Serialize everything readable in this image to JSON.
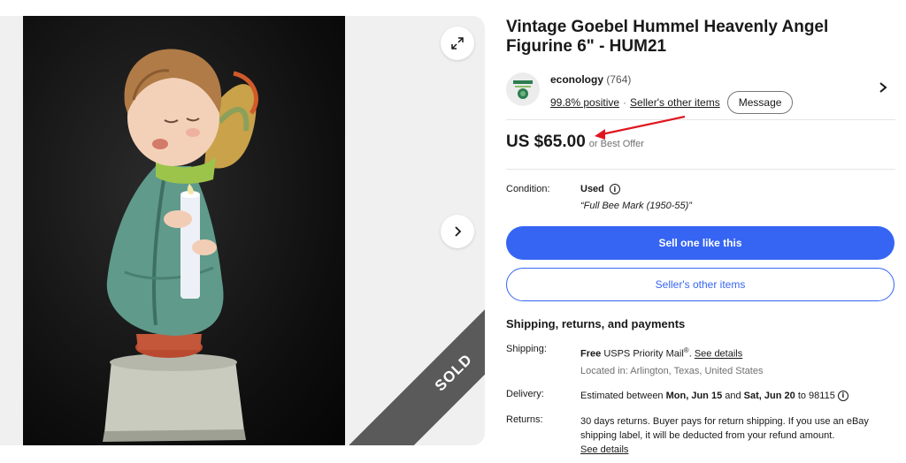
{
  "listing": {
    "title": "Vintage Goebel Hummel Heavenly Angel Figurine 6\" - HUM21",
    "sold_badge": "SOLD"
  },
  "seller": {
    "name": "econology",
    "feedback_count": "(764)",
    "positive": "99.8% positive",
    "separator": "·",
    "other_items_link": "Seller's other items",
    "message_button": "Message"
  },
  "price": {
    "amount": "US $65.00",
    "best_offer": "or Best Offer"
  },
  "condition": {
    "label": "Condition:",
    "value": "Used",
    "note": "“Full Bee Mark (1950-55)”"
  },
  "actions": {
    "sell_one": "Sell one like this",
    "seller_other_items": "Seller's other items"
  },
  "shipping": {
    "heading": "Shipping, returns, and payments",
    "shipping_label": "Shipping:",
    "shipping_free": "Free",
    "shipping_service": "USPS Priority Mail",
    "shipping_reg": "®",
    "shipping_period": ".",
    "see_details": "See details",
    "location": "Located in: Arlington, Texas, United States",
    "delivery_label": "Delivery:",
    "delivery_prefix": "Estimated between",
    "delivery_start": "Mon, Jun 15",
    "delivery_and": "and",
    "delivery_end": "Sat, Jun 20",
    "delivery_to": "to 98115",
    "returns_label": "Returns:",
    "returns_text": "30 days returns. Buyer pays for return shipping. If you use an eBay shipping label, it will be deducted from your refund amount.",
    "returns_details": "See details"
  },
  "icons": {
    "expand": "expand-icon",
    "next": "chevron-right-icon",
    "info": "info-icon",
    "seller_chevron": "chevron-right-icon"
  },
  "colors": {
    "primary": "#3665f3",
    "arrow": "#e0161f",
    "sold_ribbon": "#5a5a5a"
  }
}
